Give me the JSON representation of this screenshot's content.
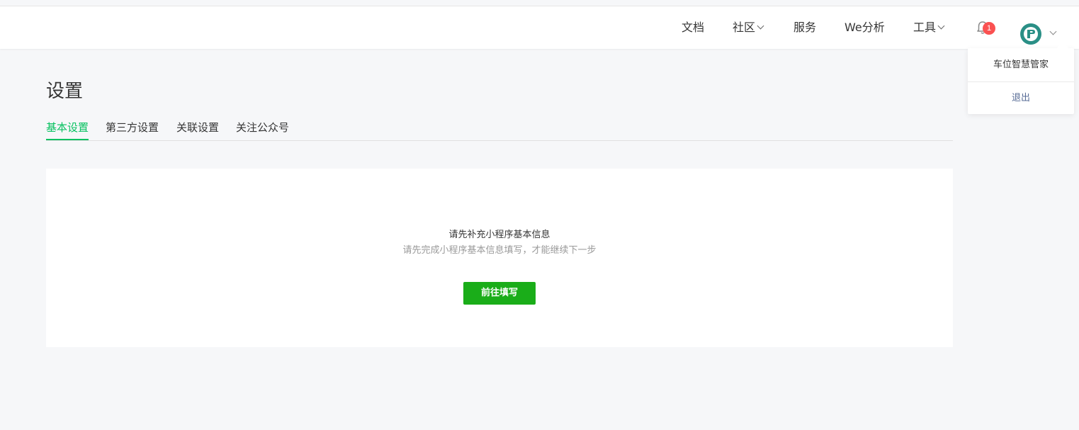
{
  "header": {
    "nav": [
      {
        "label": "文档",
        "has_dropdown": false
      },
      {
        "label": "社区",
        "has_dropdown": true
      },
      {
        "label": "服务",
        "has_dropdown": false
      },
      {
        "label": "We分析",
        "has_dropdown": false
      },
      {
        "label": "工具",
        "has_dropdown": true
      }
    ],
    "notification_count": "1",
    "accent_color": "#07c160",
    "badge_color": "#fa5151"
  },
  "account_menu": {
    "name": "车位智慧管家",
    "logout_label": "退出"
  },
  "page": {
    "title": "设置",
    "tabs": [
      {
        "label": "基本设置",
        "active": true
      },
      {
        "label": "第三方设置",
        "active": false
      },
      {
        "label": "关联设置",
        "active": false
      },
      {
        "label": "关注公众号",
        "active": false
      }
    ]
  },
  "notice": {
    "title": "请先补充小程序基本信息",
    "subtitle": "请先完成小程序基本信息填写，才能继续下一步",
    "button_label": "前往填写",
    "button_color": "#1aad19"
  }
}
